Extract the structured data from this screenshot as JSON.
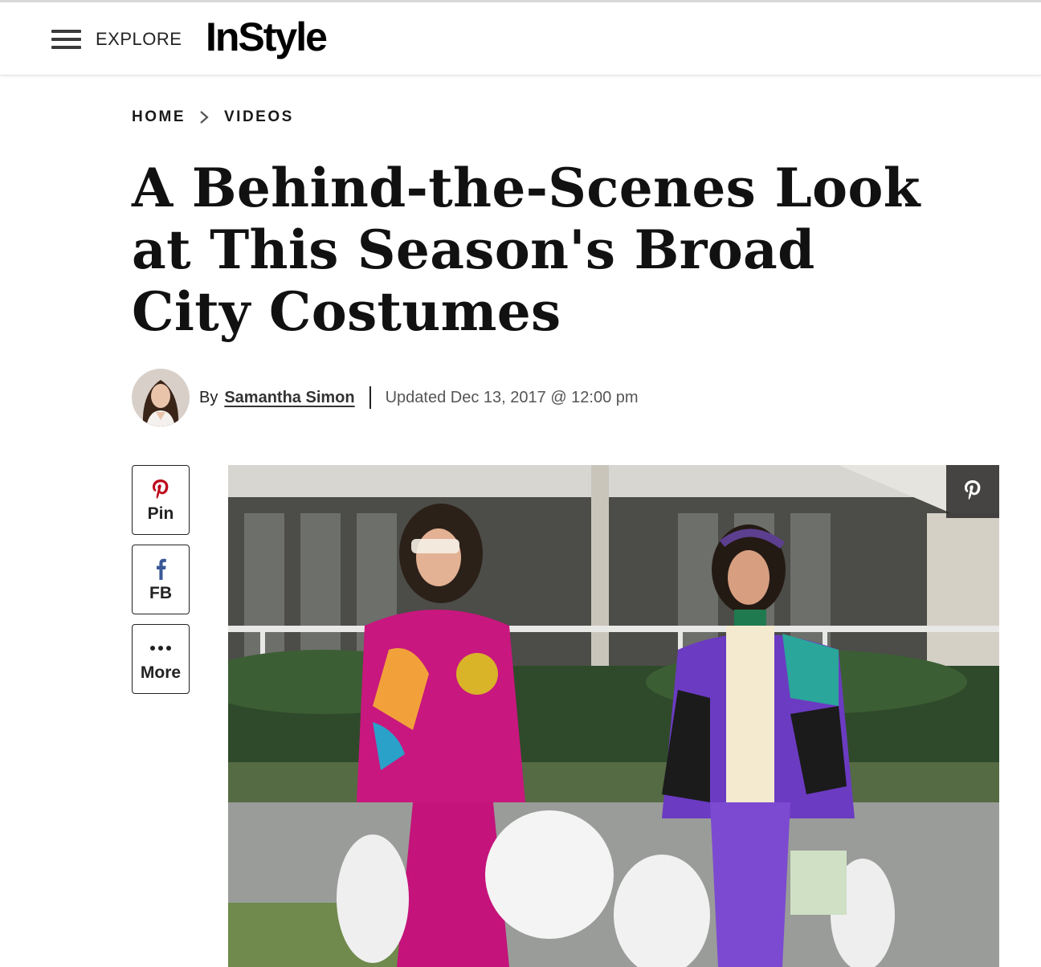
{
  "header": {
    "explore_label": "EXPLORE",
    "logo_text": "InStyle"
  },
  "breadcrumb": {
    "items": [
      "HOME",
      "VIDEOS"
    ]
  },
  "article": {
    "title": "A Behind-the-Scenes Look at This Season's Broad City Costumes",
    "by_prefix": "By",
    "author": "Samantha Simon",
    "updated": "Updated Dec 13, 2017 @ 12:00 pm"
  },
  "share": {
    "pin_label": "Pin",
    "fb_label": "FB",
    "more_label": "More",
    "icons": [
      "pinterest-icon",
      "facebook-icon",
      "more-dots-icon"
    ]
  },
  "hero": {
    "overlay_icon": "pinterest-icon"
  },
  "colors": {
    "pinterest": "#bd081c",
    "facebook": "#3b5998",
    "text": "#111111"
  }
}
